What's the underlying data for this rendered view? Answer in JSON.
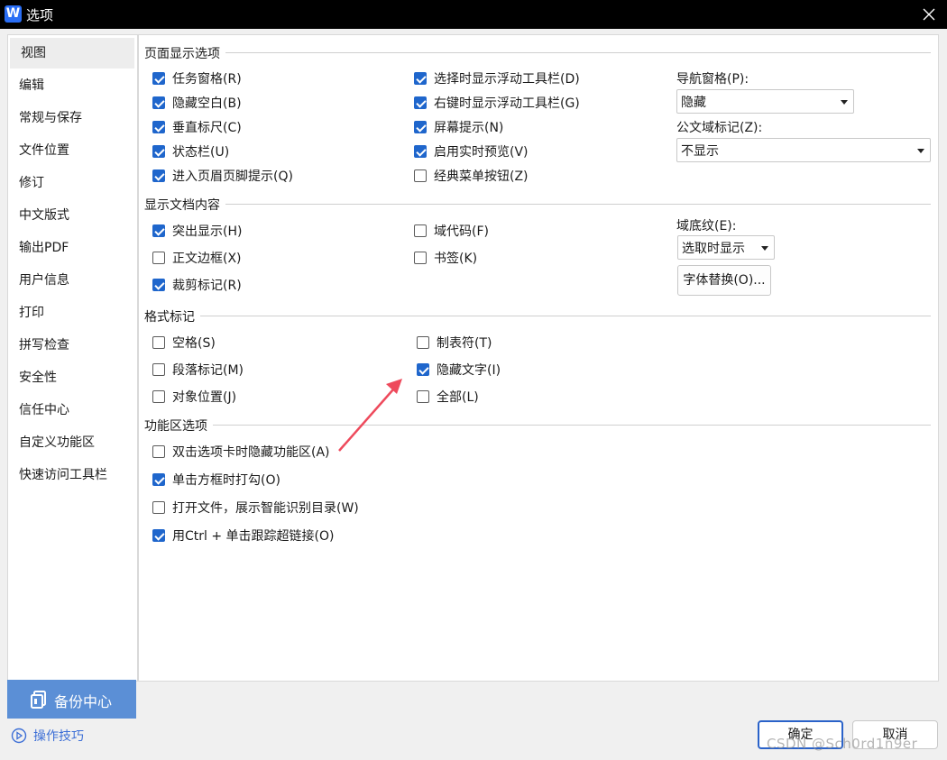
{
  "window": {
    "title": "选项",
    "logo_letter": "W"
  },
  "sidebar": {
    "items": [
      {
        "label": "视图",
        "active": true
      },
      {
        "label": "编辑"
      },
      {
        "label": "常规与保存"
      },
      {
        "label": "文件位置"
      },
      {
        "label": "修订"
      },
      {
        "label": "中文版式"
      },
      {
        "label": "输出PDF"
      },
      {
        "label": "用户信息"
      },
      {
        "label": "打印"
      },
      {
        "label": "拼写检查"
      },
      {
        "label": "安全性"
      },
      {
        "label": "信任中心"
      },
      {
        "label": "自定义功能区"
      },
      {
        "label": "快速访问工具栏"
      }
    ],
    "backup_label": "备份中心",
    "tips_label": "操作技巧"
  },
  "sections": {
    "page_display": {
      "title": "页面显示选项",
      "col1": [
        {
          "label": "任务窗格(R)",
          "checked": true
        },
        {
          "label": "隐藏空白(B)",
          "checked": true
        },
        {
          "label": "垂直标尺(C)",
          "checked": true
        },
        {
          "label": "状态栏(U)",
          "checked": true
        },
        {
          "label": "进入页眉页脚提示(Q)",
          "checked": true
        }
      ],
      "col2": [
        {
          "label": "选择时显示浮动工具栏(D)",
          "checked": true
        },
        {
          "label": "右键时显示浮动工具栏(G)",
          "checked": true
        },
        {
          "label": "屏幕提示(N)",
          "checked": true
        },
        {
          "label": "启用实时预览(V)",
          "checked": true
        },
        {
          "label": "经典菜单按钮(Z)",
          "checked": false
        }
      ],
      "nav_pane_label": "导航窗格(P):",
      "nav_pane_value": "隐藏",
      "field_mark_label": "公文域标记(Z):",
      "field_mark_value": "不显示"
    },
    "doc_content": {
      "title": "显示文档内容",
      "col1": [
        {
          "label": "突出显示(H)",
          "checked": true
        },
        {
          "label": "正文边框(X)",
          "checked": false
        },
        {
          "label": "裁剪标记(R)",
          "checked": true
        }
      ],
      "col2": [
        {
          "label": "域代码(F)",
          "checked": false
        },
        {
          "label": "书签(K)",
          "checked": false
        }
      ],
      "shading_label": "域底纹(E):",
      "shading_value": "选取时显示",
      "font_sub_button": "字体替换(O)..."
    },
    "format_marks": {
      "title": "格式标记",
      "col1": [
        {
          "label": "空格(S)",
          "checked": false
        },
        {
          "label": "段落标记(M)",
          "checked": false
        },
        {
          "label": "对象位置(J)",
          "checked": false
        }
      ],
      "col2": [
        {
          "label": "制表符(T)",
          "checked": false
        },
        {
          "label": "隐藏文字(I)",
          "checked": true
        },
        {
          "label": "全部(L)",
          "checked": false
        }
      ]
    },
    "ribbon": {
      "title": "功能区选项",
      "items": [
        {
          "label": "双击选项卡时隐藏功能区(A)",
          "checked": false
        },
        {
          "label": "单击方框时打勾(O)",
          "checked": true
        },
        {
          "label": "打开文件，展示智能识别目录(W)",
          "checked": false
        },
        {
          "label": "用Ctrl + 单击跟踪超链接(O)",
          "checked": true
        }
      ]
    }
  },
  "footer": {
    "ok_label": "确定",
    "cancel_label": "取消"
  },
  "watermark": "CSDN @Sch0rd1n9er",
  "colors": {
    "accent": "#1f66cc",
    "backup": "#5b8fd6",
    "annotation_arrow": "#ee4a5c"
  }
}
